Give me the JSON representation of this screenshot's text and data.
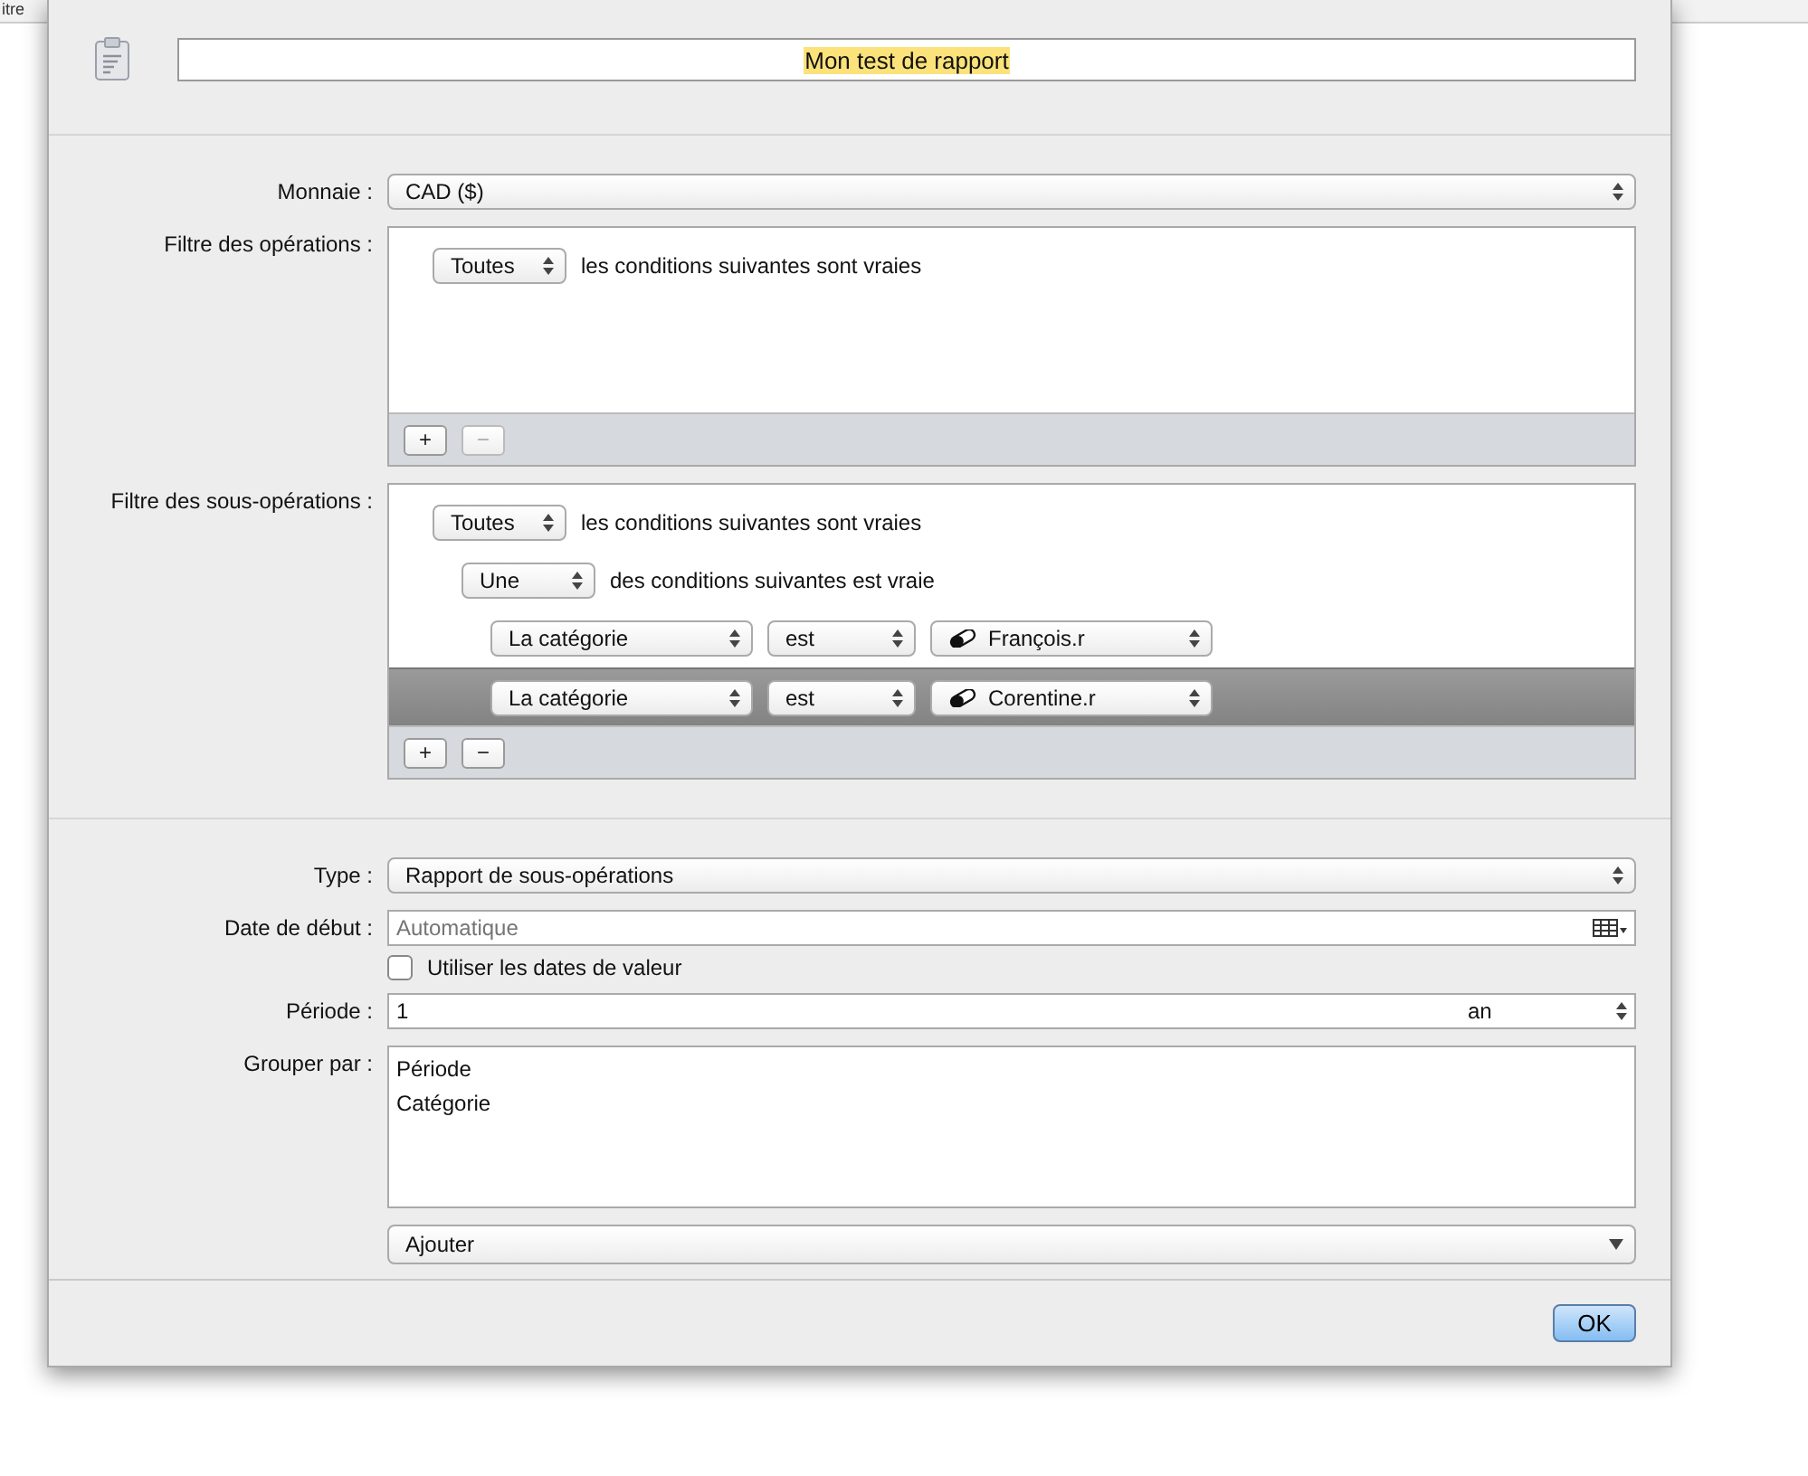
{
  "background_window": {
    "title_fragment": "itre"
  },
  "header": {
    "title_value": "Mon test de rapport"
  },
  "currency": {
    "label": "Monnaie :",
    "value": "CAD ($)"
  },
  "transaction_filter": {
    "label": "Filtre des opérations :",
    "rules": [
      {
        "kind": "group",
        "match": "Toutes",
        "text": "les conditions suivantes sont vraies",
        "selected": false
      }
    ],
    "buttons": [
      {
        "label": "+",
        "disabled": false
      },
      {
        "label": "−",
        "disabled": true
      }
    ]
  },
  "split_filter": {
    "label": "Filtre des sous-opérations :",
    "rules": [
      {
        "kind": "group",
        "match": "Toutes",
        "text": "les conditions suivantes sont vraies",
        "selected": false,
        "children": [
          {
            "kind": "group",
            "match": "Une",
            "text": "des conditions suivantes est vraie",
            "selected": false,
            "children": [
              {
                "kind": "condition",
                "field": "La catégorie",
                "operator": "est",
                "value": "François.r",
                "selected": false
              },
              {
                "kind": "condition",
                "field": "La catégorie",
                "operator": "est",
                "value": "Corentine.r",
                "selected": true
              }
            ]
          }
        ]
      }
    ],
    "buttons": [
      {
        "label": "+",
        "disabled": false
      },
      {
        "label": "−",
        "disabled": false
      }
    ]
  },
  "type": {
    "label": "Type :",
    "value": "Rapport de sous-opérations"
  },
  "start_date": {
    "label": "Date de début :",
    "placeholder": "Automatique"
  },
  "value_dates": {
    "label": "Utiliser les dates de valeur",
    "checked": false
  },
  "period": {
    "label": "Période :",
    "value": "1",
    "unit": "an"
  },
  "group_by": {
    "label": "Grouper par :",
    "items": [
      "Période",
      "Catégorie"
    ],
    "add_label": "Ajouter"
  },
  "ok_button": "OK"
}
